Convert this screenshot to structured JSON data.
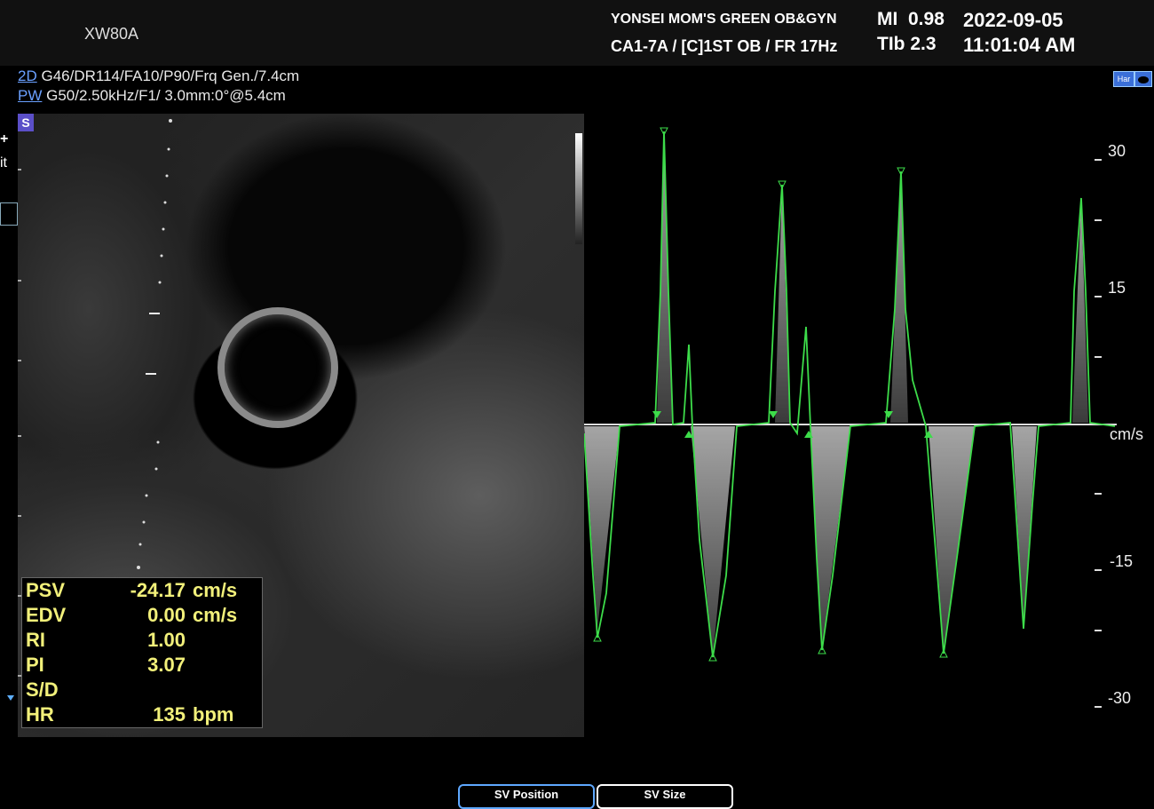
{
  "header": {
    "device": "XW80A",
    "hospital": "YONSEI MOM'S GREEN OB&GYN",
    "probe_info": "CA1-7A / [C]1ST OB / FR 17Hz",
    "mi": "MI  0.98",
    "tib": "TIb 2.3",
    "date": "2022-09-05",
    "time": "11:01:04 AM"
  },
  "params": {
    "mode_2d": "2D",
    "params_2d": "G46/DR114/FA10/P90/Frq Gen./7.4cm",
    "mode_pw": "PW",
    "params_pw": "G50/2.50kHz/F1/ 3.0mm:0°@5.4cm"
  },
  "side": {
    "s_badge": "S",
    "plus": "+",
    "it": "it"
  },
  "measurements": [
    {
      "label": "PSV",
      "value": "-24.17",
      "unit": "cm/s"
    },
    {
      "label": "EDV",
      "value": "0.00",
      "unit": "cm/s"
    },
    {
      "label": "RI",
      "value": "1.00",
      "unit": ""
    },
    {
      "label": "PI",
      "value": "3.07",
      "unit": ""
    },
    {
      "label": "S/D",
      "value": "",
      "unit": ""
    },
    {
      "label": "HR",
      "value": "135",
      "unit": "bpm"
    }
  ],
  "spectral_scale": {
    "unit": "cm/s",
    "labels": [
      "30",
      "15",
      "-15",
      "-30"
    ]
  },
  "icons": [
    "har-icon",
    "probe-icon"
  ],
  "buttons": {
    "sv_position": "SV Position",
    "sv_size": "SV Size"
  },
  "colors": {
    "trace": "#3ddc4a",
    "measure_text": "#f2f07a",
    "mode_label": "#6aa0ff"
  }
}
